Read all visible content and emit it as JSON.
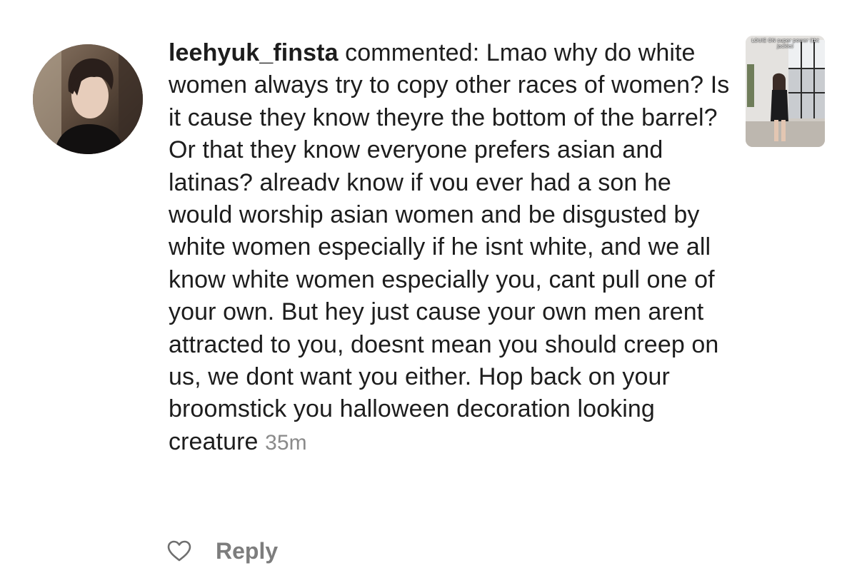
{
  "comment": {
    "username": "leehyuk_finsta",
    "action": "commented:",
    "text": "Lmao why do white women always try to copy other races of women? Is it cause they know theyre the bottom of the barrel? Or that they know everyone prefers asian and latinas? alreadv know if vou ever had a son he would worship asian women and be disgusted by white women especially if he isnt white, and we all know white women especially you, cant pull one of your own. But hey just cause your own men arent attracted to you, doesnt mean you should creep on us, we dont want you either. Hop back on your broomstick you halloween decoration looking creature",
    "timestamp": "35m"
  },
  "post_thumbnail": {
    "caption": "LOUIE ON super power (tbt jackie)"
  },
  "actions": {
    "like_icon": "heart-outline-icon",
    "reply_label": "Reply"
  },
  "colors": {
    "text": "#1d1d1d",
    "timestamp": "#8a8a8a",
    "reply": "#7d7d7d",
    "background": "#ffffff"
  }
}
